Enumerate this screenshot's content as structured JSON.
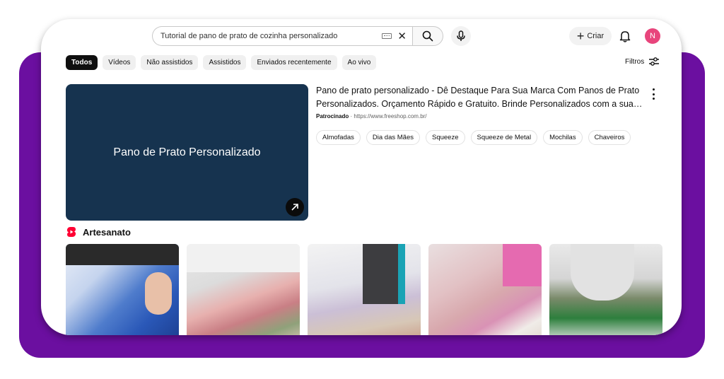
{
  "header": {
    "search_value": "Tutorial de pano de prato de cozinha personalizado",
    "create_label": "Criar",
    "avatar_letter": "N"
  },
  "chips": [
    "Todos",
    "Vídeos",
    "Não assistidos",
    "Assistidos",
    "Enviados recentemente",
    "Ao vivo"
  ],
  "filters_label": "Filtros",
  "ad": {
    "thumbnail_title": "Pano de Prato Personalizado",
    "title_line1": "Pano de prato personalizado - Dê Destaque Para Sua Marca Com Panos de Prato",
    "title_line2": "Personalizados. Orçamento Rápido e Gratuito. Brinde Personalizados com a sua…",
    "sponsored_label": "Patrocinado",
    "separator": "·",
    "url": "https://www.freeshop.com.br/",
    "sitelinks": [
      "Almofadas",
      "Dia das Mães",
      "Squeeze",
      "Squeeze de Metal",
      "Mochilas",
      "Chaveiros"
    ]
  },
  "shorts": {
    "section_title": "Artesanato"
  },
  "colors": {
    "frame_purple": "#6b0fa0",
    "ad_thumbnail_bg": "#16334f",
    "avatar_pink": "#e8457c",
    "shorts_red": "#ff0033"
  }
}
